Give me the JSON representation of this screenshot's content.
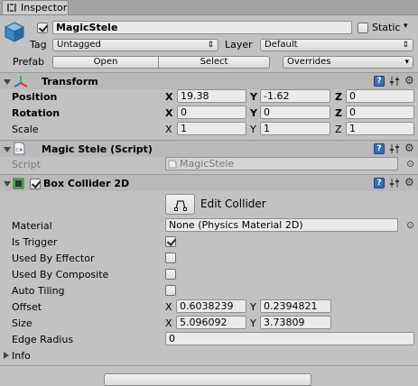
{
  "window": {
    "tab_label": "Inspector"
  },
  "header": {
    "object_name": "MagicStele",
    "active": true,
    "static_label": "Static",
    "static_checked": false,
    "tag_label": "Tag",
    "tag_value": "Untagged",
    "layer_label": "Layer",
    "layer_value": "Default",
    "prefab_label": "Prefab",
    "open_label": "Open",
    "select_label": "Select",
    "overrides_label": "Overrides"
  },
  "transform": {
    "title": "Transform",
    "position_label": "Position",
    "rotation_label": "Rotation",
    "scale_label": "Scale",
    "position": {
      "x": "19.38",
      "y": "-1.62",
      "z": "0"
    },
    "rotation": {
      "x": "0",
      "y": "0",
      "z": "0"
    },
    "scale": {
      "x": "1",
      "y": "1",
      "z": "1"
    },
    "axis_x": "X",
    "axis_y": "Y",
    "axis_z": "Z"
  },
  "script_component": {
    "title": "Magic Stele (Script)",
    "script_label": "Script",
    "script_value": "MagicStele"
  },
  "box_collider": {
    "title": "Box Collider 2D",
    "enabled": true,
    "edit_collider_label": "Edit Collider",
    "material_label": "Material",
    "material_value": "None (Physics Material 2D)",
    "is_trigger_label": "Is Trigger",
    "is_trigger": true,
    "used_by_effector_label": "Used By Effector",
    "used_by_effector": false,
    "used_by_composite_label": "Used By Composite",
    "used_by_composite": false,
    "auto_tiling_label": "Auto Tiling",
    "auto_tiling": false,
    "offset_label": "Offset",
    "offset": {
      "x": "0.6038239",
      "y": "0.2394821"
    },
    "size_label": "Size",
    "size": {
      "x": "5.096092",
      "y": "3.73809"
    },
    "edge_radius_label": "Edge Radius",
    "edge_radius": "0",
    "info_label": "Info"
  },
  "icons": {
    "help": "?",
    "gear": "⚙",
    "dropdown_arrow": "⇕"
  }
}
